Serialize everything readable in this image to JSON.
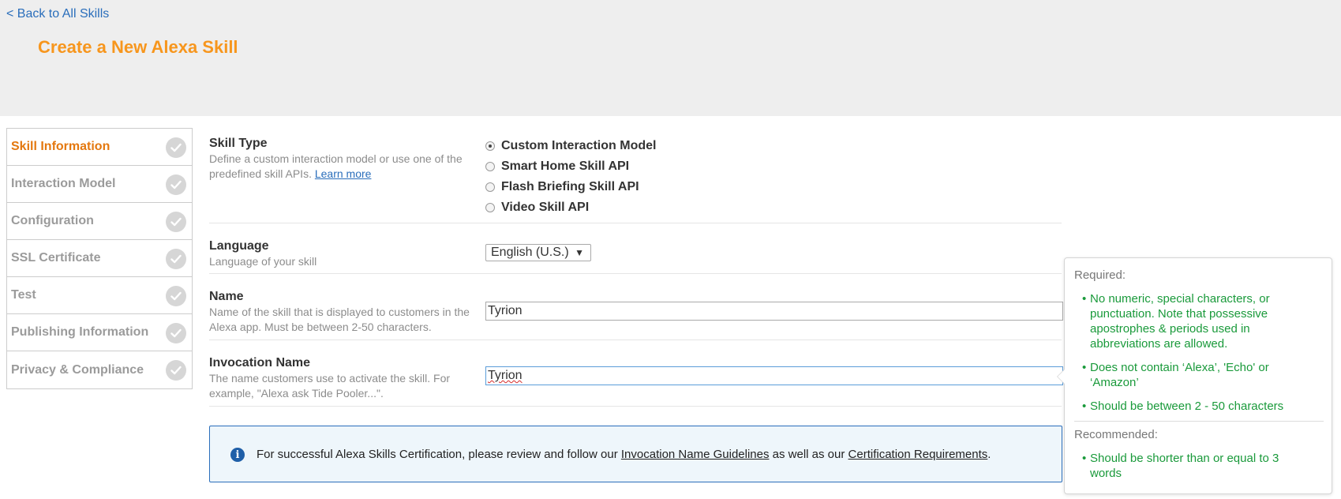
{
  "header": {
    "back_link": "< Back to All Skills",
    "title": "Create a New Alexa Skill"
  },
  "sidebar": {
    "items": [
      {
        "label": "Skill Information",
        "active": true
      },
      {
        "label": "Interaction Model",
        "active": false
      },
      {
        "label": "Configuration",
        "active": false
      },
      {
        "label": "SSL Certificate",
        "active": false
      },
      {
        "label": "Test",
        "active": false
      },
      {
        "label": "Publishing Information",
        "active": false
      },
      {
        "label": "Privacy & Compliance",
        "active": false
      }
    ]
  },
  "form": {
    "skill_type": {
      "title": "Skill Type",
      "description": "Define a custom interaction model or use one of the predefined skill APIs.",
      "learn_more": "Learn more",
      "options": [
        {
          "label": "Custom Interaction Model",
          "checked": true
        },
        {
          "label": "Smart Home Skill API",
          "checked": false
        },
        {
          "label": "Flash Briefing Skill API",
          "checked": false
        },
        {
          "label": "Video Skill API",
          "checked": false
        }
      ]
    },
    "language": {
      "title": "Language",
      "description": "Language of your skill",
      "selected": "English (U.S.)"
    },
    "name": {
      "title": "Name",
      "description": "Name of the skill that is displayed to customers in the Alexa app. Must be between 2-50 characters.",
      "value": "Tyrion"
    },
    "invocation": {
      "title": "Invocation Name",
      "description": "The name customers use to activate the skill. For example, \"Alexa ask Tide Pooler...\".",
      "value": "Tyrion"
    }
  },
  "info": {
    "text_before": "For successful Alexa Skills Certification, please review and follow our ",
    "link1": "Invocation Name Guidelines",
    "text_middle": " as well as our ",
    "link2": "Certification Requirements",
    "text_after": "."
  },
  "tooltip": {
    "required_heading": "Required:",
    "required_items": [
      "No numeric, special characters, or punctuation. Note that possessive apostrophes & periods used in abbreviations are allowed.",
      "Does not contain ‘Alexa’, 'Echo' or ‘Amazon’",
      "Should be between 2 - 50 characters"
    ],
    "recommended_heading": "Recommended:",
    "recommended_items": [
      "Should be shorter than or equal to 3 words"
    ]
  },
  "colors": {
    "title_orange": "#f7961d",
    "active_orange": "#e4780f",
    "link_blue": "#2a6ebb",
    "tooltip_green": "#1a9a3b"
  },
  "icons": {
    "check": "check-circle-icon",
    "info": "info-circle-icon",
    "dropdown": "dropdown-arrow-icon"
  }
}
